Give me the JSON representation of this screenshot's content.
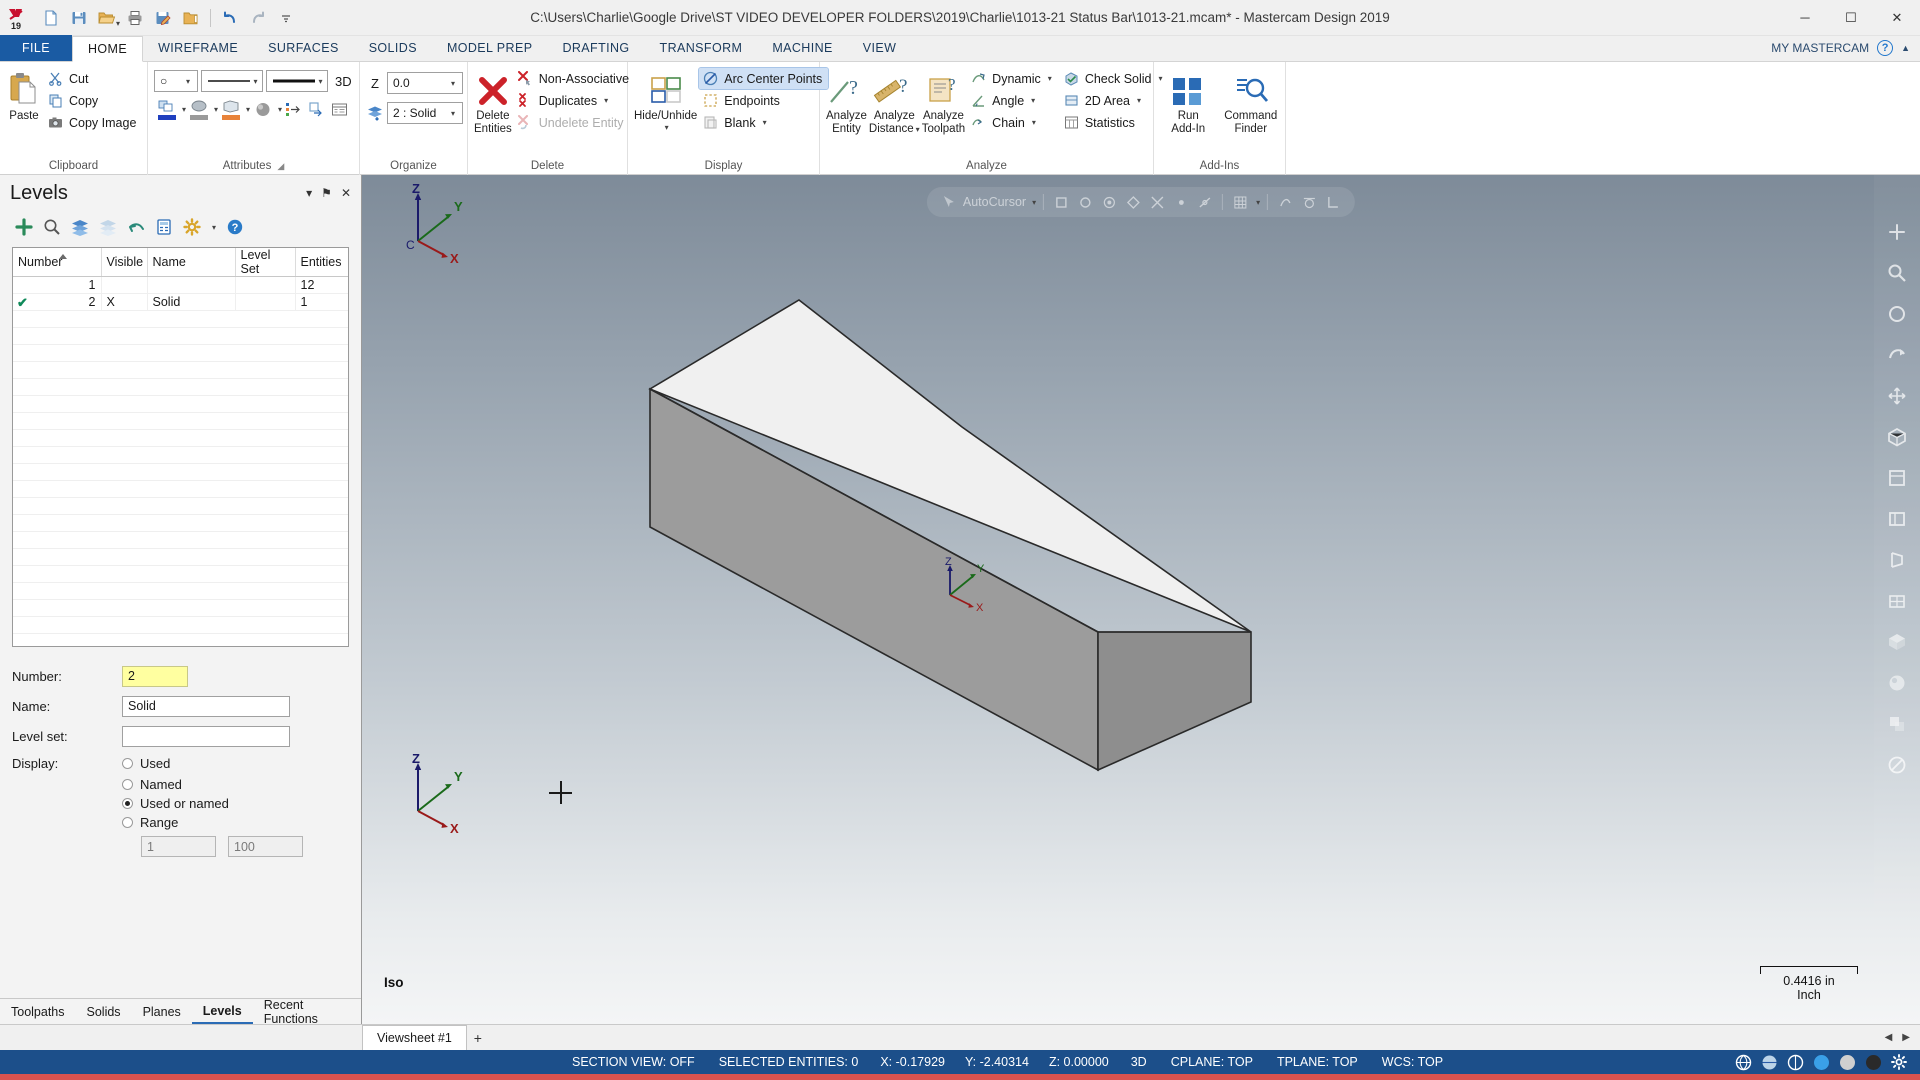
{
  "titlebar": {
    "title": "C:\\Users\\Charlie\\Google Drive\\ST VIDEO DEVELOPER FOLDERS\\2019\\Charlie\\1013-21 Status Bar\\1013-21.mcam* - Mastercam Design 2019",
    "logo_text": "19",
    "quick_access": [
      {
        "name": "new-file-icon",
        "tip": "New"
      },
      {
        "name": "save-icon",
        "tip": "Save"
      },
      {
        "name": "open-folder-icon",
        "tip": "Open"
      },
      {
        "name": "print-icon",
        "tip": "Print"
      },
      {
        "name": "edit-file-icon",
        "tip": "Save As"
      },
      {
        "name": "folder-icon",
        "tip": "Browse"
      },
      {
        "name": "undo-icon",
        "tip": "Undo"
      },
      {
        "name": "redo-icon",
        "tip": "Redo"
      },
      {
        "name": "customize-icon",
        "tip": "Customize Quick Access Toolbar"
      }
    ],
    "window_buttons": {
      "minimize": "─",
      "maximize": "☐",
      "close": "✕"
    }
  },
  "tabs": {
    "items": [
      "FILE",
      "HOME",
      "WIREFRAME",
      "SURFACES",
      "SOLIDS",
      "MODEL PREP",
      "DRAFTING",
      "TRANSFORM",
      "MACHINE",
      "VIEW"
    ],
    "active": "HOME",
    "right_label": "MY MASTERCAM",
    "help_glyph": "?"
  },
  "ribbon": {
    "groups": [
      {
        "title": "Clipboard",
        "paste_label": "Paste",
        "items": [
          {
            "label": "Cut",
            "icon": "scissors-icon"
          },
          {
            "label": "Copy",
            "icon": "copy-icon"
          },
          {
            "label": "Copy Image",
            "icon": "camera-icon"
          }
        ]
      },
      {
        "title": "Attributes",
        "has_dialog_launcher": true,
        "point_style": "○",
        "line_style": "solid",
        "line_width": "thick",
        "dim3d_label": "3D",
        "swatch_colors": [
          "#1f3fbf",
          "#9a9a9a",
          "#e8833a"
        ],
        "mini_icons": [
          "set-level-icon",
          "swap-attributes-icon",
          "attributes-manager-icon"
        ]
      },
      {
        "title": "Organize",
        "z_label": "Z",
        "z_value": "0.0",
        "level_icon": "levels-icon",
        "level_value": "2 : Solid"
      },
      {
        "title": "Delete",
        "big": {
          "label_line1": "Delete",
          "label_line2": "Entities",
          "icon": "red-x-icon"
        },
        "items": [
          {
            "label": "Non-Associative",
            "icon": "delete-nonassoc-icon",
            "disabled": false
          },
          {
            "label": "Duplicates",
            "icon": "delete-duplicates-icon",
            "disabled": false,
            "dropdown": true
          },
          {
            "label": "Undelete Entity",
            "icon": "undelete-icon",
            "disabled": true
          }
        ]
      },
      {
        "title": "Display",
        "big": {
          "label_line1": "Hide/Unhide",
          "icon": "hide-unhide-icon",
          "dropdown": true
        },
        "items": [
          {
            "label": "Arc Center Points",
            "icon": "arc-center-points-icon",
            "checked": true
          },
          {
            "label": "Endpoints",
            "icon": "endpoints-icon",
            "checked": false
          },
          {
            "label": "Blank",
            "icon": "blank-icon",
            "checked": false,
            "dropdown": true
          }
        ]
      },
      {
        "title": "Analyze",
        "big_buttons": [
          {
            "label_line1": "Analyze",
            "label_line2": "Entity",
            "icon": "analyze-entity-icon"
          },
          {
            "label_line1": "Analyze",
            "label_line2": "Distance",
            "icon": "analyze-distance-icon",
            "dropdown": true
          },
          {
            "label_line1": "Analyze",
            "label_line2": "Toolpath",
            "icon": "analyze-toolpath-icon"
          }
        ],
        "items": [
          {
            "label": "Dynamic",
            "icon": "dynamic-icon",
            "dropdown": true
          },
          {
            "label": "Angle",
            "icon": "angle-icon",
            "dropdown": true
          },
          {
            "label": "Chain",
            "icon": "chain-icon",
            "dropdown": true
          },
          {
            "label": "Check Solid",
            "icon": "check-solid-icon",
            "dropdown": true
          },
          {
            "label": "2D Area",
            "icon": "area-2d-icon",
            "dropdown": true
          },
          {
            "label": "Statistics",
            "icon": "statistics-icon"
          }
        ]
      },
      {
        "title": "Add-Ins",
        "big_buttons": [
          {
            "label_line1": "Run",
            "label_line2": "Add-In",
            "icon": "run-addin-icon"
          },
          {
            "label_line1": "Command",
            "label_line2": "Finder",
            "icon": "command-finder-icon"
          }
        ]
      }
    ]
  },
  "levels_panel": {
    "title": "Levels",
    "header_buttons": [
      {
        "name": "panel-dropdown-icon",
        "glyph": "▾"
      },
      {
        "name": "panel-pin-icon",
        "glyph": "⚑"
      },
      {
        "name": "panel-close-icon",
        "glyph": "✕"
      }
    ],
    "toolbar": [
      {
        "name": "add-level-icon",
        "glyph": "+"
      },
      {
        "name": "find-level-icon",
        "glyph": "search"
      },
      {
        "name": "show-all-levels-icon",
        "glyph": "layers"
      },
      {
        "name": "hide-all-levels-icon",
        "glyph": "layers-light"
      },
      {
        "name": "undo-level-icon",
        "glyph": "arrow"
      },
      {
        "name": "level-list-icon",
        "glyph": "list"
      },
      {
        "name": "level-options-icon",
        "glyph": "gear",
        "dropdown": true
      },
      {
        "name": "level-help-icon",
        "glyph": "?"
      }
    ],
    "columns": [
      "Number",
      "Visible",
      "Name",
      "Level Set",
      "Entities"
    ],
    "sort_column": "Number",
    "sort_direction": "ascending",
    "rows": [
      {
        "active": false,
        "number": "1",
        "visible": "",
        "name": "",
        "level_set": "",
        "entities": "12"
      },
      {
        "active": true,
        "number": "2",
        "visible": "X",
        "name": "Solid",
        "level_set": "",
        "entities": "1"
      }
    ],
    "properties": {
      "number_label": "Number:",
      "number_value": "2",
      "name_label": "Name:",
      "name_value": "Solid",
      "level_set_label": "Level set:",
      "level_set_value": "",
      "display_label": "Display:",
      "display_options": [
        {
          "label": "Used",
          "selected": false
        },
        {
          "label": "Named",
          "selected": false
        },
        {
          "label": "Used or named",
          "selected": true
        },
        {
          "label": "Range",
          "selected": false
        }
      ],
      "range_from": "1",
      "range_to": "100"
    },
    "bottom_tabs": [
      {
        "label": "Toolpaths",
        "active": false
      },
      {
        "label": "Solids",
        "active": false
      },
      {
        "label": "Planes",
        "active": false
      },
      {
        "label": "Levels",
        "active": true
      },
      {
        "label": "Recent Functions",
        "active": false
      }
    ]
  },
  "viewport": {
    "autocursor_label": "AutoCursor",
    "autocursor_icons": [
      "autocursor-icon",
      "autocursor-dropdown",
      "endpoint-snap-icon",
      "midpoint-snap-icon",
      "center-snap-icon",
      "quadrant-snap-icon",
      "intersect-snap-icon",
      "point-snap-icon",
      "nearest-snap-icon",
      "grid-snap-icon",
      "relative-snap-icon",
      "tangent-snap-icon",
      "perpendicular-snap-icon"
    ],
    "view_name": "Iso",
    "scale_value": "0.4416 in",
    "scale_unit": "Inch",
    "gnomon_top": {
      "x": "X",
      "y": "Y",
      "z": "Z",
      "origin": "C"
    },
    "gnomon_bottom": {
      "x": "X",
      "y": "Y",
      "z": "Z"
    },
    "gnomon_model": {
      "x": "X",
      "y": "Y",
      "z": "Z"
    },
    "right_toolbar": [
      {
        "name": "fit-icon",
        "glyph": "+"
      },
      {
        "name": "zoom-window-icon",
        "glyph": "zoom"
      },
      {
        "name": "unzoom-icon",
        "glyph": "circle"
      },
      {
        "name": "dynamic-rotate-icon",
        "glyph": "rotate"
      },
      {
        "name": "pan-icon",
        "glyph": "pan"
      },
      {
        "name": "isometric-view-icon",
        "glyph": "iso"
      },
      {
        "name": "top-view-icon",
        "glyph": "top"
      },
      {
        "name": "front-view-icon",
        "glyph": "front"
      },
      {
        "name": "right-view-icon",
        "glyph": "right"
      },
      {
        "name": "wireframe-shading-icon",
        "glyph": "wire"
      },
      {
        "name": "shaded-view-icon",
        "glyph": "shade"
      },
      {
        "name": "material-icon",
        "glyph": "mat"
      },
      {
        "name": "translucency-icon",
        "glyph": "trans"
      },
      {
        "name": "no-shading-icon",
        "glyph": "none"
      }
    ]
  },
  "sheetbar": {
    "tab_label": "Viewsheet #1",
    "add_glyph": "+",
    "nav_left": "◀",
    "nav_right": "▶"
  },
  "statusbar": {
    "section_view": "SECTION VIEW: OFF",
    "selected_entities": "SELECTED ENTITIES: 0",
    "x_label": "X:",
    "x_value": "-0.17929",
    "y_label": "Y:",
    "y_value": "-2.40314",
    "z_label": "Z:",
    "z_value": "0.00000",
    "mode_3d": "3D",
    "cplane": "CPLANE: TOP",
    "tplane": "TPLANE: TOP",
    "wcs": "WCS: TOP",
    "right_icons": [
      {
        "name": "wireframe-display-icon",
        "glyph": "globe"
      },
      {
        "name": "shaded-display-icon",
        "glyph": "globe2"
      },
      {
        "name": "shaded-wireframe-icon",
        "glyph": "globe3"
      },
      {
        "name": "blue-dot-icon",
        "color": "#3aa0e8"
      },
      {
        "name": "grey-dot-icon",
        "color": "#cfcfcf"
      },
      {
        "name": "dark-dot-icon",
        "color": "#2a2a2a"
      },
      {
        "name": "settings-icon",
        "glyph": "gear"
      }
    ]
  },
  "colors": {
    "accent": "#1c4f8a",
    "ribbon_bg": "#ffffff",
    "panel_bg": "#f3f3f3",
    "highlight": "#cfe0f5",
    "yellow_field": "#ffffa0",
    "solid_top": "#efefef",
    "solid_front": "#9a9a9a",
    "solid_side": "#8c8c8c"
  }
}
